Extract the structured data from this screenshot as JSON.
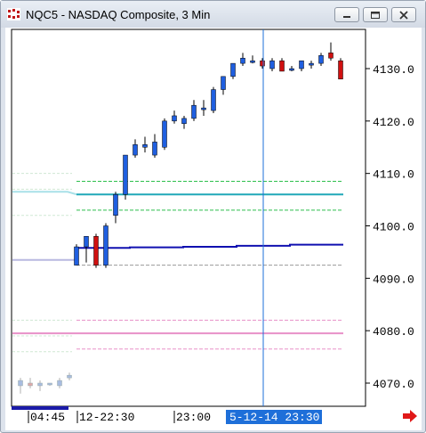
{
  "window": {
    "title": "NQC5 - NASDAQ Composite, 3 Min",
    "icon": "chart-app-icon",
    "buttons": [
      "minimize-icon",
      "maximize-icon",
      "close-icon"
    ]
  },
  "colors": {
    "background": "#ffffff",
    "candle_up": "#1f5fe0",
    "candle_down": "#d01010",
    "cursor_line": "#1e6fd9",
    "time_highlight": "#1e6fd9",
    "time_bar_left": "#1a1aa8",
    "nav_arrow": "#e01818",
    "avg_line": "#1010b0",
    "cyan_line": "#20a8b8",
    "green_dash": "#2cbf4c",
    "pink_line": "#e890c8",
    "gray_dash": "#9a9a9a"
  },
  "chart_data": {
    "type": "candlestick",
    "symbol": "NQC5",
    "interval": "3 Min",
    "y_axis": {
      "min": 4065,
      "max": 4137,
      "ticks": [
        "4070.0",
        "4080.0",
        "4090.0",
        "4100.0",
        "4110.0",
        "4120.0",
        "4130.0"
      ]
    },
    "time_labels": [
      "04:45",
      "12-22:30",
      "23:00"
    ],
    "cursor_label": "5-12-14 23:30:0",
    "candles": [
      {
        "o": 4069.5,
        "h": 4071.0,
        "l": 4068.0,
        "c": 4070.5
      },
      {
        "o": 4070.0,
        "h": 4071.0,
        "l": 4069.0,
        "c": 4069.5
      },
      {
        "o": 4069.5,
        "h": 4070.5,
        "l": 4068.5,
        "c": 4070.0
      },
      {
        "o": 4070.0,
        "h": 4070.0,
        "l": 4069.5,
        "c": 4070.0
      },
      {
        "o": 4069.5,
        "h": 4071.0,
        "l": 4069.0,
        "c": 4070.5
      },
      {
        "o": 4071.0,
        "h": 4072.0,
        "l": 4070.5,
        "c": 4071.5
      },
      {
        "o": 4092.5,
        "h": 4096.5,
        "l": 4092.5,
        "c": 4096.0
      },
      {
        "o": 4096.0,
        "h": 4097.5,
        "l": 4093.0,
        "c": 4098.0
      },
      {
        "o": 4098.0,
        "h": 4098.5,
        "l": 4092.0,
        "c": 4092.5
      },
      {
        "o": 4092.5,
        "h": 4100.5,
        "l": 4092.0,
        "c": 4100.0
      },
      {
        "o": 4102.0,
        "h": 4106.5,
        "l": 4100.5,
        "c": 4106.0
      },
      {
        "o": 4106.0,
        "h": 4113.5,
        "l": 4105.0,
        "c": 4113.5
      },
      {
        "o": 4113.5,
        "h": 4116.5,
        "l": 4113.0,
        "c": 4115.5
      },
      {
        "o": 4115.0,
        "h": 4117.0,
        "l": 4114.0,
        "c": 4115.5
      },
      {
        "o": 4113.5,
        "h": 4117.5,
        "l": 4113.0,
        "c": 4116.0
      },
      {
        "o": 4115.0,
        "h": 4120.5,
        "l": 4114.5,
        "c": 4120.0
      },
      {
        "o": 4120.0,
        "h": 4122.0,
        "l": 4119.5,
        "c": 4121.0
      },
      {
        "o": 4119.5,
        "h": 4121.0,
        "l": 4118.5,
        "c": 4120.5
      },
      {
        "o": 4120.5,
        "h": 4124.0,
        "l": 4120.0,
        "c": 4123.0
      },
      {
        "o": 4122.5,
        "h": 4124.0,
        "l": 4121.0,
        "c": 4122.5
      },
      {
        "o": 4122.0,
        "h": 4126.5,
        "l": 4121.5,
        "c": 4126.0
      },
      {
        "o": 4126.0,
        "h": 4128.5,
        "l": 4125.0,
        "c": 4128.5
      },
      {
        "o": 4128.5,
        "h": 4131.0,
        "l": 4128.0,
        "c": 4131.0
      },
      {
        "o": 4131.0,
        "h": 4133.0,
        "l": 4130.5,
        "c": 4132.0
      },
      {
        "o": 4131.5,
        "h": 4132.5,
        "l": 4131.0,
        "c": 4131.5
      },
      {
        "o": 4131.5,
        "h": 4132.0,
        "l": 4130.0,
        "c": 4130.5
      },
      {
        "o": 4130.0,
        "h": 4132.0,
        "l": 4129.5,
        "c": 4131.5
      },
      {
        "o": 4131.5,
        "h": 4132.0,
        "l": 4129.5,
        "c": 4129.5
      },
      {
        "o": 4130.0,
        "h": 4130.5,
        "l": 4129.5,
        "c": 4130.0
      },
      {
        "o": 4130.0,
        "h": 4131.5,
        "l": 4129.5,
        "c": 4131.5
      },
      {
        "o": 4131.0,
        "h": 4131.5,
        "l": 4130.0,
        "c": 4131.0
      },
      {
        "o": 4131.0,
        "h": 4133.0,
        "l": 4130.5,
        "c": 4132.5
      },
      {
        "o": 4133.0,
        "h": 4135.0,
        "l": 4131.5,
        "c": 4132.0
      },
      {
        "o": 4131.5,
        "h": 4132.0,
        "l": 4128.0,
        "c": 4128.0
      }
    ],
    "levels_session1": {
      "cyan": 4106.5,
      "lavender": 4093.5
    },
    "levels_session2": {
      "green_upper": 4108.5,
      "cyan": 4106.0,
      "green_lower": 4103.0,
      "gray": 4092.5,
      "pink_upper": 4082.0,
      "pink_mid": 4079.5,
      "pink_lower": 4076.5
    },
    "session1_faint_lines": [
      4110.0,
      4107.0,
      4102.0,
      4082.0,
      4079.0,
      4076.0
    ],
    "blue_avg_line": [
      4095.8,
      4095.9,
      4096.0,
      4096.2,
      4096.4
    ],
    "cursor_candle_index": 25
  }
}
